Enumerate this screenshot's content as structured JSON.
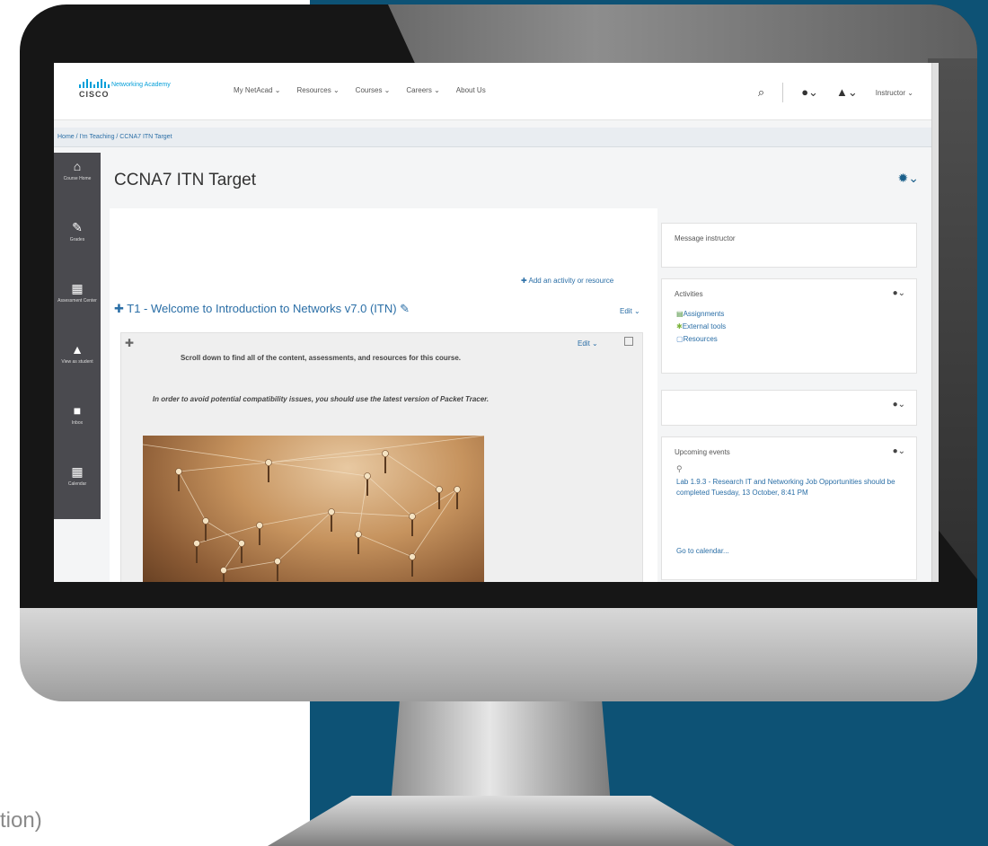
{
  "footer_fragment": "tion)",
  "header": {
    "logo_word": "CISCO",
    "logo_tag": "Networking Academy",
    "nav": [
      "My NetAcad ⌄",
      "Resources ⌄",
      "Courses ⌄",
      "Careers ⌄",
      "About Us"
    ],
    "user": "Instructor ⌄"
  },
  "breadcrumb": "Home / I'm Teaching / CCNA7 ITN Target",
  "sidebar": {
    "items": [
      {
        "label": "Course Home",
        "icon": "home-icon",
        "glyph": "⌂"
      },
      {
        "label": "Grades",
        "icon": "grades-icon",
        "glyph": "✎"
      },
      {
        "label": "Assessment Center",
        "icon": "assessment-icon",
        "glyph": "▦"
      },
      {
        "label": "View as student",
        "icon": "student-icon",
        "glyph": "▲"
      },
      {
        "label": "Inbox",
        "icon": "inbox-icon",
        "glyph": "■"
      },
      {
        "label": "Calendar",
        "icon": "calendar-icon",
        "glyph": "▦"
      }
    ]
  },
  "page": {
    "title": "CCNA7 ITN Target",
    "add_activity": "✚ Add an activity or resource",
    "section_title": "✚ T1 - Welcome to Introduction to Networks v7.0 (ITN) ✎",
    "section_edit": "Edit ⌄",
    "box_edit": "Edit ⌄",
    "note1": "Scroll down to find all of the content, assessments, and resources for this course.",
    "note2": "In order to avoid potential compatibility issues, you should use the latest version of Packet Tracer."
  },
  "blocks": {
    "message": "Message instructor",
    "activities_title": "Activities",
    "activities": [
      "Assignments",
      "External tools",
      "Resources"
    ],
    "events_title": "Upcoming events",
    "event_text": "Lab 1.9.3 - Research IT and Networking Job Opportunities should be completed Tuesday, 13 October, 8:41 PM",
    "calendar_link": "Go to calendar..."
  },
  "colors": {
    "backdrop": "#0d5275",
    "link": "#2a6ea6",
    "sidebar": "#4a4a4f",
    "cisco_blue": "#049fd9"
  }
}
